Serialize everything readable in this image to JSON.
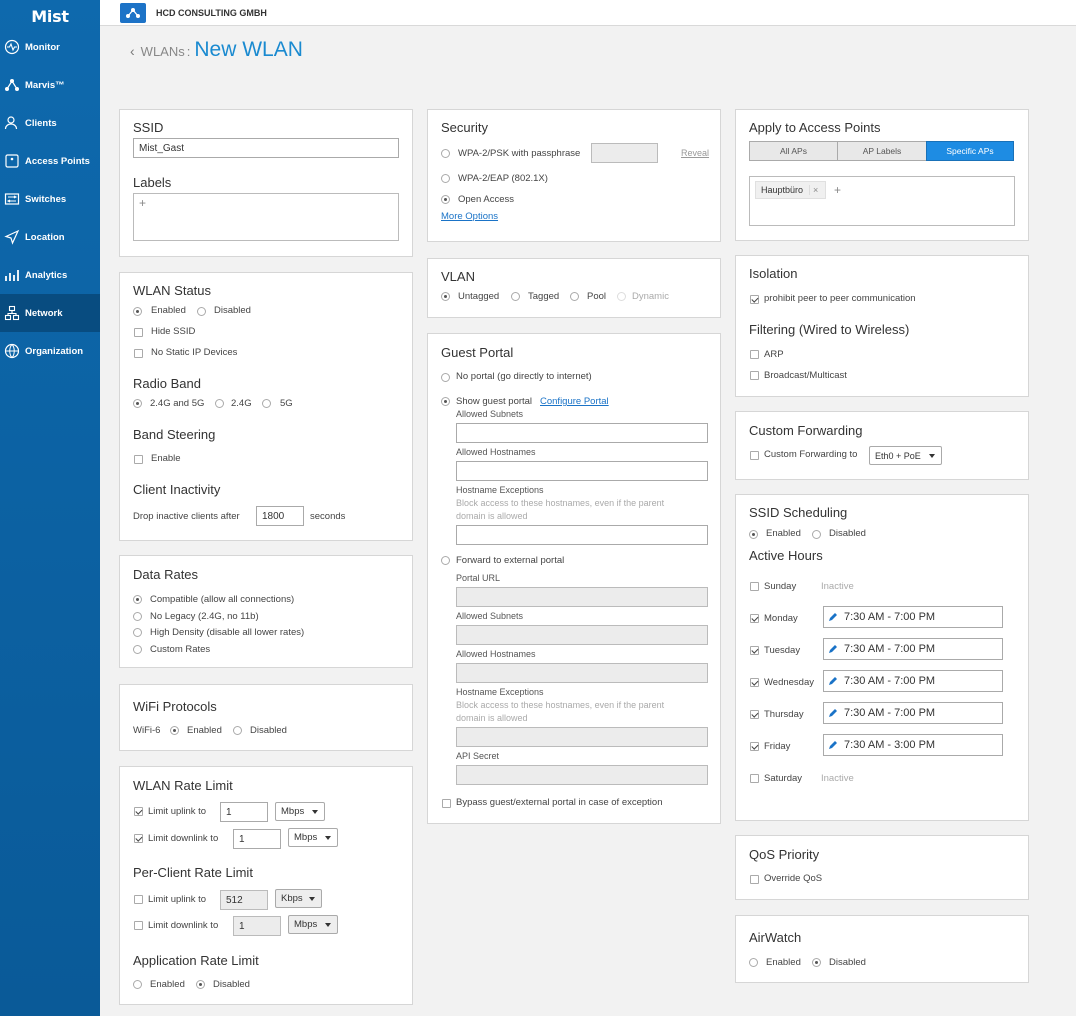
{
  "app": {
    "logo": "Mist",
    "org": "HCD CONSULTING GMBH"
  },
  "nav": [
    {
      "label": "Monitor",
      "icon": "monitor-icon"
    },
    {
      "label": "Marvis™",
      "icon": "marvis-icon"
    },
    {
      "label": "Clients",
      "icon": "clients-icon"
    },
    {
      "label": "Access Points",
      "icon": "access-points-icon"
    },
    {
      "label": "Switches",
      "icon": "switches-icon"
    },
    {
      "label": "Location",
      "icon": "location-icon"
    },
    {
      "label": "Analytics",
      "icon": "analytics-icon"
    },
    {
      "label": "Network",
      "icon": "network-icon",
      "active": true
    },
    {
      "label": "Organization",
      "icon": "organization-icon"
    }
  ],
  "breadcrumb": {
    "parent": "WLANs",
    "separator": ":",
    "title": "New WLAN"
  },
  "ssid": {
    "heading": "SSID",
    "value": "Mist_Gast",
    "labels_heading": "Labels",
    "add": "+"
  },
  "wlan_status": {
    "heading": "WLAN Status",
    "enabled": "Enabled",
    "disabled": "Disabled",
    "hide_ssid": "Hide SSID",
    "no_static_ip": "No Static IP Devices",
    "radio_band_heading": "Radio Band",
    "band_both": "2.4G and 5G",
    "band_24": "2.4G",
    "band_5": "5G",
    "band_steering_heading": "Band Steering",
    "band_steering_enable": "Enable",
    "inactivity_heading": "Client Inactivity",
    "drop_label": "Drop inactive clients after",
    "drop_value": "1800",
    "seconds": "seconds"
  },
  "data_rates": {
    "heading": "Data Rates",
    "options": [
      "Compatible (allow all connections)",
      "No Legacy (2.4G, no 11b)",
      "High Density (disable all lower rates)",
      "Custom Rates"
    ],
    "selected": 0
  },
  "wifi_protocols": {
    "heading": "WiFi Protocols",
    "wifi6": "WiFi-6",
    "enabled": "Enabled",
    "disabled": "Disabled"
  },
  "rate_limit": {
    "heading": "WLAN Rate Limit",
    "uplink_label": "Limit uplink to",
    "uplink_value": "1",
    "uplink_unit": "Mbps",
    "downlink_label": "Limit downlink to",
    "downlink_value": "1",
    "downlink_unit": "Mbps",
    "per_client_heading": "Per-Client Rate Limit",
    "pc_uplink_label": "Limit uplink to",
    "pc_uplink_value": "512",
    "pc_uplink_unit": "Kbps",
    "pc_downlink_label": "Limit downlink to",
    "pc_downlink_value": "1",
    "pc_downlink_unit": "Mbps",
    "app_heading": "Application Rate Limit",
    "app_enabled": "Enabled",
    "app_disabled": "Disabled"
  },
  "security": {
    "heading": "Security",
    "psk": "WPA-2/PSK with passphrase",
    "reveal": "Reveal",
    "eap": "WPA-2/EAP (802.1X)",
    "open": "Open Access",
    "more": "More Options"
  },
  "vlan": {
    "heading": "VLAN",
    "untagged": "Untagged",
    "tagged": "Tagged",
    "pool": "Pool",
    "dynamic": "Dynamic"
  },
  "guest_portal": {
    "heading": "Guest Portal",
    "no_portal": "No portal (go directly to internet)",
    "show_portal": "Show guest portal",
    "configure": "Configure Portal",
    "allowed_subnets": "Allowed Subnets",
    "allowed_hostnames": "Allowed Hostnames",
    "hostname_exceptions": "Hostname Exceptions",
    "exceptions_help": "Block access to these hostnames, even if the parent domain is allowed",
    "forward": "Forward to external portal",
    "portal_url": "Portal URL",
    "api_secret": "API Secret",
    "bypass": "Bypass guest/external portal in case of exception"
  },
  "apply_aps": {
    "heading": "Apply to Access Points",
    "all": "All APs",
    "labels": "AP Labels",
    "specific": "Specific APs",
    "tag": "Hauptbüro",
    "tag_x": "×",
    "add": "+"
  },
  "isolation": {
    "heading": "Isolation",
    "peer": "prohibit peer to peer communication",
    "filtering_heading": "Filtering (Wired to Wireless)",
    "arp": "ARP",
    "broadcast": "Broadcast/Multicast"
  },
  "custom_forwarding": {
    "heading": "Custom Forwarding",
    "label": "Custom Forwarding to",
    "value": "Eth0 + PoE"
  },
  "scheduling": {
    "heading": "SSID Scheduling",
    "enabled": "Enabled",
    "disabled": "Disabled",
    "active_hours": "Active Hours",
    "days": [
      {
        "day": "Sunday",
        "checked": false,
        "hours": "Inactive"
      },
      {
        "day": "Monday",
        "checked": true,
        "hours": "7:30 AM - 7:00 PM"
      },
      {
        "day": "Tuesday",
        "checked": true,
        "hours": "7:30 AM - 7:00 PM"
      },
      {
        "day": "Wednesday",
        "checked": true,
        "hours": "7:30 AM - 7:00 PM"
      },
      {
        "day": "Thursday",
        "checked": true,
        "hours": "7:30 AM - 7:00 PM"
      },
      {
        "day": "Friday",
        "checked": true,
        "hours": "7:30 AM - 3:00 PM"
      },
      {
        "day": "Saturday",
        "checked": false,
        "hours": "Inactive"
      }
    ]
  },
  "qos": {
    "heading": "QoS Priority",
    "override": "Override QoS"
  },
  "airwatch": {
    "heading": "AirWatch",
    "enabled": "Enabled",
    "disabled": "Disabled"
  }
}
